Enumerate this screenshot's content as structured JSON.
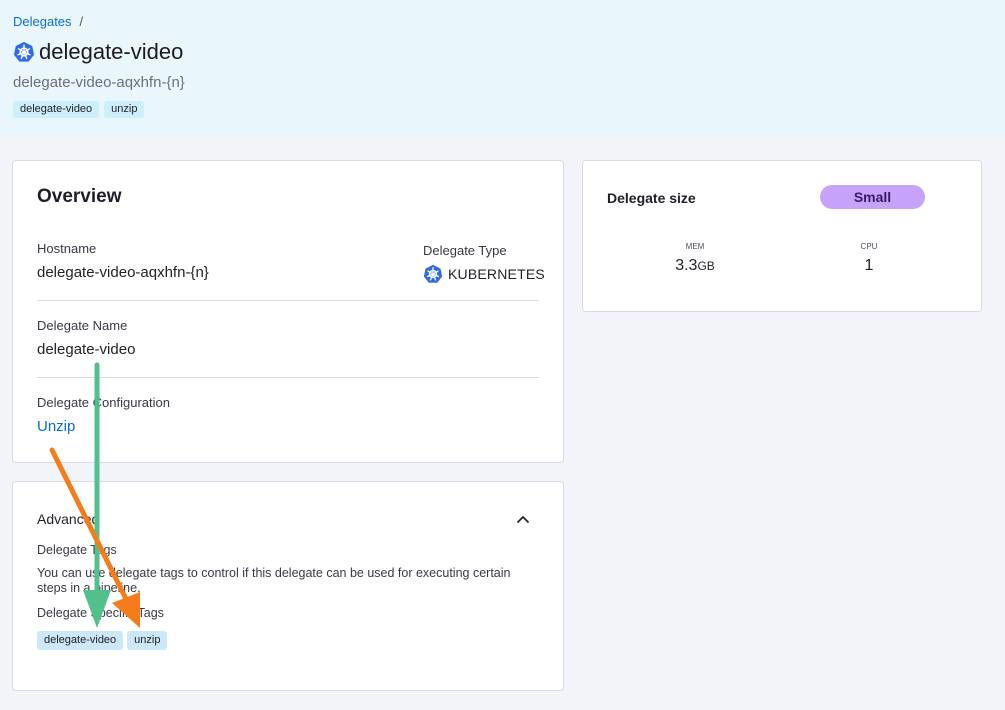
{
  "breadcrumb": {
    "parent": "Delegates",
    "separator": "/"
  },
  "header": {
    "title": "delegate-video",
    "subtitle": "delegate-video-aqxhfn-{n}",
    "icon": "kubernetes-icon",
    "tags": [
      "delegate-video",
      "unzip"
    ]
  },
  "overview": {
    "title": "Overview",
    "hostname_label": "Hostname",
    "hostname_value": "delegate-video-aqxhfn-{n}",
    "type_label": "Delegate Type",
    "type_value": "KUBERNETES",
    "name_label": "Delegate Name",
    "name_value": "delegate-video",
    "config_label": "Delegate Configuration",
    "config_value": "Unzip"
  },
  "size": {
    "title": "Delegate size",
    "badge": "Small",
    "mem_label": "MEM",
    "mem_value": "3.3",
    "mem_unit": "GB",
    "cpu_label": "CPU",
    "cpu_value": "1"
  },
  "advanced": {
    "title": "Advanced",
    "tags_label": "Delegate Tags",
    "description": "You can use delegate tags to control if this delegate can be used for executing certain steps in a pipeline.",
    "specific_label": "Delegate Specific Tags",
    "tags": [
      "delegate-video",
      "unzip"
    ]
  },
  "colors": {
    "brand_blue": "#0a6ed1",
    "header_bg": "#e9f6fc",
    "badge_purple": "#c6a3f8",
    "arrow_green": "#52c08a",
    "arrow_orange": "#f57c1a"
  }
}
